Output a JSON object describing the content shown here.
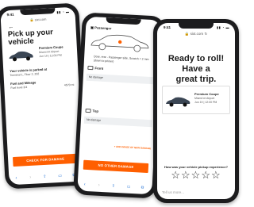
{
  "left_screen": {
    "time": "9:41",
    "url": "sixt.com",
    "title": "Pick up your vehicle",
    "car": {
      "name": "Premium Coupe",
      "location": "Miami Int Airport",
      "datetime": "Jun 19 | 12:00 PM"
    },
    "parked_label": "Your vehicle is parked at",
    "parked_value": "Terminal 1, Floor 2, 202",
    "fuel_label": "Fuel and Mileage",
    "fuel_value": "Fuel level 3/4",
    "mileage_value": "4570 mi",
    "button": "CHECK FOR DAMAGE"
  },
  "middle_screen": {
    "passenger": "Passenger",
    "damage_note": "Door, rear - Passenger side, Scratch < 2 mm (down to primer)",
    "front_label": "Front",
    "front_value": "No damage",
    "top_label": "Top",
    "top_value": "No damage",
    "add_image": "+ ADD IMAGE OF NEW DAMAGE",
    "button": "NO OTHER DAMAGE"
  },
  "right_screen": {
    "time": "9:41",
    "url": "sixt.com",
    "title_line1": "Ready to roll! Have a",
    "title_line2": "great trip.",
    "car": {
      "name": "Premium Coupe",
      "location": "Miami Int Airport",
      "datetime": "Jun 19 | 12:00 PM"
    },
    "rating_question": "How was your vehicle pickup experience?",
    "stars": "☆☆☆☆☆",
    "tell_more": "Tell us more..."
  },
  "colors": {
    "accent": "#ff5f00",
    "link": "#2b77d6"
  }
}
